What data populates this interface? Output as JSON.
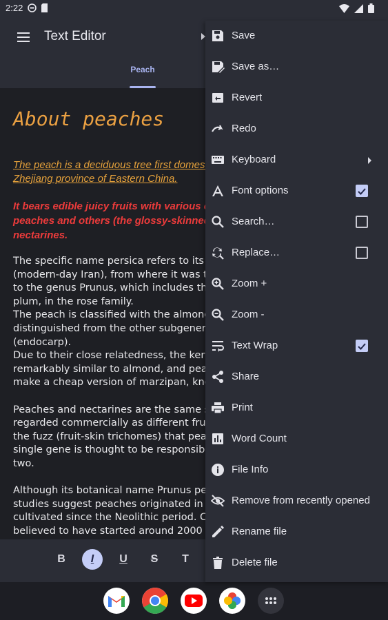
{
  "status_bar": {
    "time": "2:22"
  },
  "app_bar": {
    "title": "Text Editor",
    "tab_label": "Peach"
  },
  "document": {
    "title": "About peaches",
    "para_orange": "The peach is a deciduous tree first domesticated and cultivated in\nZhejiang province of Eastern China.",
    "para_red": "It bears edible juicy fruits with various characteristics, most called\npeaches and others (the glossy-skinned, non-fuzzy varieties),\nnectarines.",
    "para_body": "The specific name persica refers to its widespread cultivation in Persia\n(modern-day Iran), from where it was transplanted to Europe. It belongs\nto the genus Prunus, which includes the cherry, apricot, almond, and\nplum, in the rose family.\nThe peach is classified with the almond in the subgenus Amygdalus,\ndistinguished from the other subgenera by the corrugated seed shell\n(endocarp).\nDue to their close relatedness, the kernel of a peach stone tastes\nremarkably similar to almond, and peach stones are often used to\nmake a cheap version of marzipan, known as persipan.\n\nPeaches and nectarines are the same species, even though they are\nregarded commercially as different fruits. In contrast to peaches,\nthe fuzz (fruit-skin trichomes) that peaches have is absent; a\nsingle gene is thought to be responsible for the difference between the\ntwo.\n\nAlthough its botanical name Prunus persica suggests the peach is native to Persia, genetic\nstudies suggest peaches originated in China, where they have been\ncultivated since the Neolithic period. Cultivation is\nbelieved to have started around 2000 BCE."
  },
  "format_bar": {
    "bold": "B",
    "italic": "I",
    "underline": "U",
    "strike": "S",
    "size": "T"
  },
  "menu": {
    "items": [
      {
        "label": "Save",
        "icon": "save-icon"
      },
      {
        "label": "Save as…",
        "icon": "save-as-icon"
      },
      {
        "label": "Revert",
        "icon": "revert-icon"
      },
      {
        "label": "Redo",
        "icon": "redo-icon"
      },
      {
        "label": "Keyboard",
        "icon": "keyboard-icon",
        "submenu": true
      },
      {
        "label": "Font options",
        "icon": "font-icon",
        "checked": true
      },
      {
        "label": "Search…",
        "icon": "search-icon",
        "checked": false
      },
      {
        "label": "Replace…",
        "icon": "replace-icon",
        "checked": false
      },
      {
        "label": "Zoom +",
        "icon": "zoom-in-icon"
      },
      {
        "label": "Zoom -",
        "icon": "zoom-out-icon"
      },
      {
        "label": "Text Wrap",
        "icon": "wrap-icon",
        "checked": true
      },
      {
        "label": "Share",
        "icon": "share-icon"
      },
      {
        "label": "Print",
        "icon": "print-icon"
      },
      {
        "label": "Word Count",
        "icon": "bar-chart-icon"
      },
      {
        "label": "File Info",
        "icon": "info-icon"
      },
      {
        "label": "Remove from recently opened",
        "icon": "hide-icon"
      },
      {
        "label": "Rename file",
        "icon": "pencil-icon"
      },
      {
        "label": "Delete file",
        "icon": "trash-icon"
      }
    ]
  },
  "dock": {
    "apps": [
      {
        "name": "Gmail",
        "icon": "gmail-icon"
      },
      {
        "name": "Chrome",
        "icon": "chrome-icon"
      },
      {
        "name": "YouTube",
        "icon": "youtube-icon"
      },
      {
        "name": "Photos",
        "icon": "photos-icon"
      },
      {
        "name": "Apps",
        "icon": "app-drawer-icon"
      }
    ]
  },
  "colors": {
    "accent": "#c4cdf7",
    "title_orange": "#eaa042",
    "text_red": "#ec3b3b",
    "editor_bg": "#1e1f24",
    "surface": "#2b2d36"
  }
}
